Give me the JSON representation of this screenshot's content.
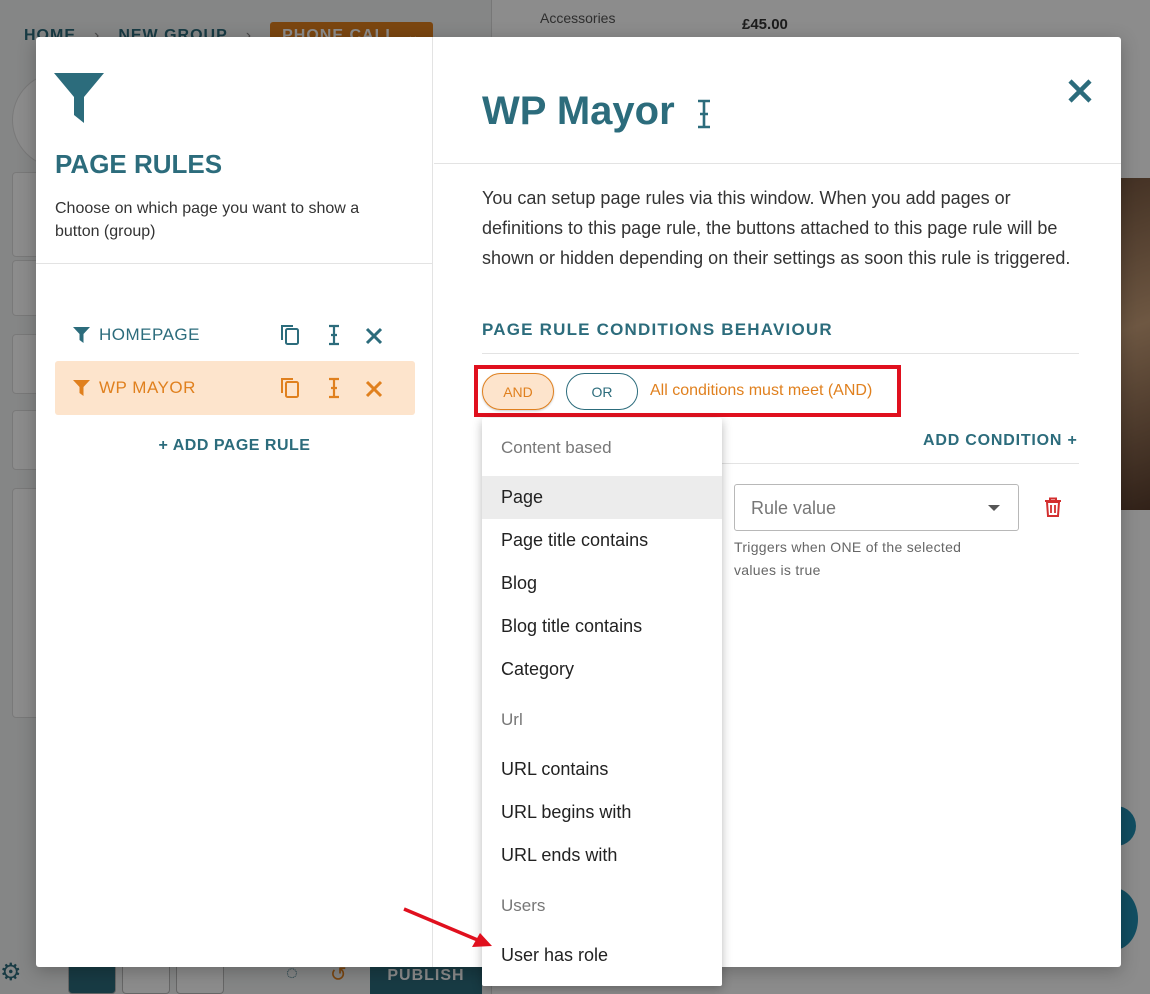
{
  "background": {
    "breadcrumb": [
      "HOME",
      "NEW GROUP"
    ],
    "breadcrumb_tag": "PHONE CALL",
    "product_category": "Accessories",
    "product_price": "£45.00",
    "publish_label": "PUBLISH"
  },
  "modal": {
    "left": {
      "title": "PAGE RULES",
      "description": "Choose on which page you want to show a button (group)",
      "rules": [
        {
          "name": "HOMEPAGE",
          "active": false
        },
        {
          "name": "WP MAYOR",
          "active": true
        }
      ],
      "add_rule_label": "+ ADD PAGE RULE"
    },
    "right": {
      "title": "WP Mayor",
      "intro": "You can setup page rules via this window. When you add pages or definitions to this page rule, the buttons attached to this page rule will be shown or hidden depending on their settings as soon this rule is triggered.",
      "behaviour_title": "PAGE RULE CONDITIONS BEHAVIOUR",
      "and_label": "AND",
      "or_label": "OR",
      "behaviour_status": "All conditions must meet (AND)",
      "add_condition_label": "ADD CONDITION +",
      "rule_value_placeholder": "Rule value",
      "hint": "Triggers when ONE of the selected values is true"
    }
  },
  "dropdown": {
    "groups": [
      {
        "label": "Content based",
        "items": [
          "Page",
          "Page title contains",
          "Blog",
          "Blog title contains",
          "Category"
        ]
      },
      {
        "label": "Url",
        "items": [
          "URL contains",
          "URL begins with",
          "URL ends with"
        ]
      },
      {
        "label": "Users",
        "items": [
          "User has role"
        ]
      }
    ],
    "selected": "Page"
  },
  "colors": {
    "brand": "#2c6c7c",
    "accent": "#e0801e",
    "accent_bg": "#fde4cc",
    "highlight": "#e0101e",
    "delete": "#d32f2f"
  }
}
